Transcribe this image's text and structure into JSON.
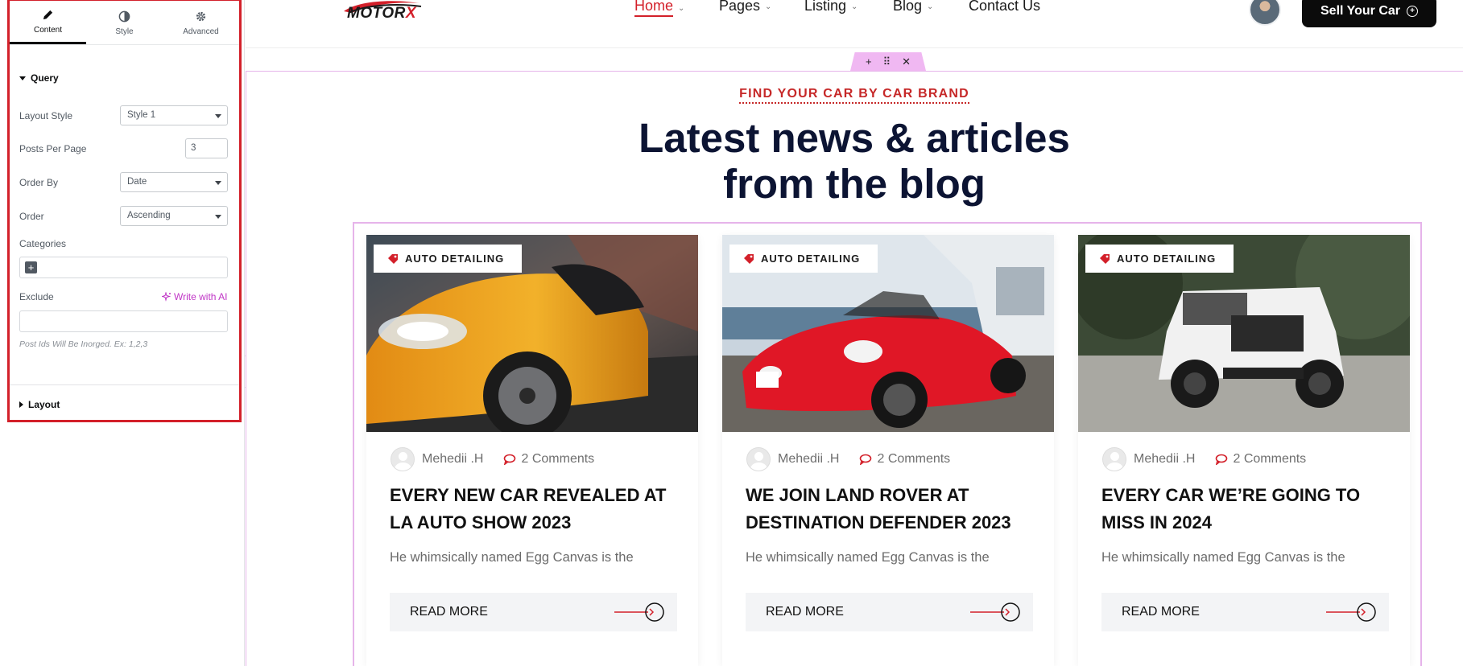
{
  "panel": {
    "tabs": [
      {
        "label": "Content",
        "icon": "pencil-icon"
      },
      {
        "label": "Style",
        "icon": "half-circle-icon"
      },
      {
        "label": "Advanced",
        "icon": "gear-icon"
      }
    ],
    "query_section": "Query",
    "controls": {
      "layout_style": {
        "label": "Layout Style",
        "value": "Style 1"
      },
      "posts_per_page": {
        "label": "Posts Per Page",
        "value": "3"
      },
      "order_by": {
        "label": "Order By",
        "value": "Date"
      },
      "order": {
        "label": "Order",
        "value": "Ascending"
      },
      "categories": {
        "label": "Categories"
      },
      "exclude": {
        "label": "Exclude",
        "ai_label": "Write with AI",
        "help": "Post Ids Will Be Inorged. Ex: 1,2,3"
      }
    },
    "layout_section": "Layout",
    "highlight_color": "#d3202a"
  },
  "site": {
    "logo_prefix": "MOTOR",
    "logo_suffix": "X",
    "nav": [
      {
        "label": "Home",
        "dropdown": true,
        "active": true
      },
      {
        "label": "Pages",
        "dropdown": true
      },
      {
        "label": "Listing",
        "dropdown": true
      },
      {
        "label": "Blog",
        "dropdown": true
      },
      {
        "label": "Contact Us",
        "dropdown": false
      }
    ],
    "sell_button": "Sell Your Car",
    "accent": "#d3202a"
  },
  "section": {
    "handle_icons": [
      "+",
      "⠿",
      "✕"
    ],
    "kicker": "FIND YOUR CAR BY CAR BRAND",
    "headline_1": "Latest news & articles",
    "headline_2": "from the blog"
  },
  "posts": [
    {
      "tag": "AUTO DETAILING",
      "author": "Mehedii .H",
      "comments": "2 Comments",
      "title": "EVERY NEW CAR REVEALED AT LA AUTO SHOW 2023",
      "excerpt": "He whimsically named Egg Canvas is the",
      "read_more": "READ MORE",
      "image": "yellow-sports-car"
    },
    {
      "tag": "AUTO DETAILING",
      "author": "Mehedii .H",
      "comments": "2 Comments",
      "title": "WE JOIN LAND ROVER AT DESTINATION DEFENDER 2023",
      "excerpt": "He whimsically named Egg Canvas is the",
      "read_more": "READ MORE",
      "image": "red-convertible"
    },
    {
      "tag": "AUTO DETAILING",
      "author": "Mehedii .H",
      "comments": "2 Comments",
      "title": "EVERY CAR WE’RE GOING TO MISS IN 2024",
      "excerpt": "He whimsically named Egg Canvas is the",
      "read_more": "READ MORE",
      "image": "white-jeep"
    }
  ]
}
